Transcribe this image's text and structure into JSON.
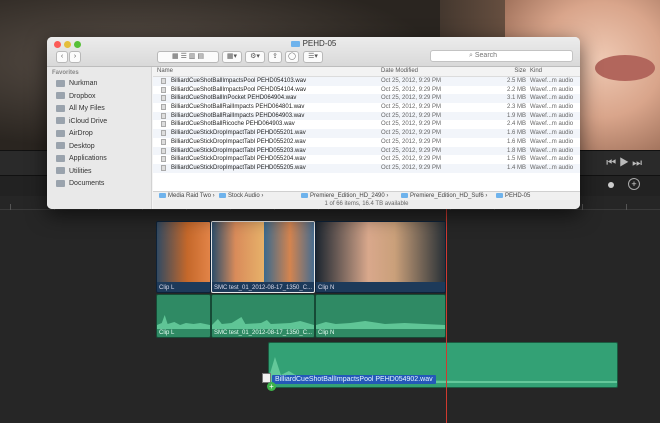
{
  "finder": {
    "title": "PEHD-05",
    "search_placeholder": "Search",
    "favorites_header": "Favorites",
    "sidebar_items": [
      "Nurkman",
      "Dropbox",
      "All My Files",
      "iCloud Drive",
      "AirDrop",
      "Desktop",
      "Applications",
      "Utilities",
      "Documents"
    ],
    "columns": {
      "name": "Name",
      "date": "Date Modified",
      "size": "Size",
      "kind": "Kind"
    },
    "files": [
      {
        "name": "BilliardCueShotBallImpactsPool PEHD054103.wav",
        "date": "Oct 25, 2012, 9:29 PM",
        "size": "2.5 MB",
        "kind": "Wavef...m audio"
      },
      {
        "name": "BilliardCueShotBallImpactsPool PEHD054104.wav",
        "date": "Oct 25, 2012, 9:29 PM",
        "size": "2.2 MB",
        "kind": "Wavef...m audio"
      },
      {
        "name": "BilliardCueShotBallInPocket PEHD064904.wav",
        "date": "Oct 25, 2012, 9:29 PM",
        "size": "3.1 MB",
        "kind": "Wavef...m audio"
      },
      {
        "name": "BilliardCueShotBallRailImpacts PEHD064801.wav",
        "date": "Oct 25, 2012, 9:29 PM",
        "size": "2.3 MB",
        "kind": "Wavef...m audio"
      },
      {
        "name": "BilliardCueShotBallRailImpacts PEHD064903.wav",
        "date": "Oct 25, 2012, 9:29 PM",
        "size": "1.9 MB",
        "kind": "Wavef...m audio"
      },
      {
        "name": "BilliardCueShotBallRicoche PEHD064903.wav",
        "date": "Oct 25, 2012, 9:29 PM",
        "size": "2.4 MB",
        "kind": "Wavef...m audio"
      },
      {
        "name": "BilliardCueStickDropImpactTabl PEHD055201.wav",
        "date": "Oct 25, 2012, 9:29 PM",
        "size": "1.6 MB",
        "kind": "Wavef...m audio"
      },
      {
        "name": "BilliardCueStickDropImpactTabl PEHD055202.wav",
        "date": "Oct 25, 2012, 9:29 PM",
        "size": "1.6 MB",
        "kind": "Wavef...m audio"
      },
      {
        "name": "BilliardCueStickDropImpactTabl PEHD055203.wav",
        "date": "Oct 25, 2012, 9:29 PM",
        "size": "1.8 MB",
        "kind": "Wavef...m audio"
      },
      {
        "name": "BilliardCueStickDropImpactTabl PEHD055204.wav",
        "date": "Oct 25, 2012, 9:29 PM",
        "size": "1.5 MB",
        "kind": "Wavef...m audio"
      },
      {
        "name": "BilliardCueStickDropImpactTabl PEHD055205.wav",
        "date": "Oct 25, 2012, 9:29 PM",
        "size": "1.4 MB",
        "kind": "Wavef...m audio"
      }
    ],
    "path": [
      "Media Raid Two",
      "Stock Audio",
      "Premiere_Edition_HD_2490",
      "Premiere_Edition_HD_Suf6",
      "PEHD-05"
    ],
    "status": "1 of 66 items, 16.4 TB available"
  },
  "timeline": {
    "clips": [
      {
        "label": "Clip L"
      },
      {
        "label": "SMC test_01_2012-08-17_1350_C..."
      },
      {
        "label": "Clip N"
      }
    ],
    "audio_labels": [
      "Clip L",
      "SMC test_01_2012-08-17_1350_C...",
      "Clip N"
    ],
    "drag_label": "BilliardCueShotBallImpactsPool PEHD054902.wav"
  }
}
